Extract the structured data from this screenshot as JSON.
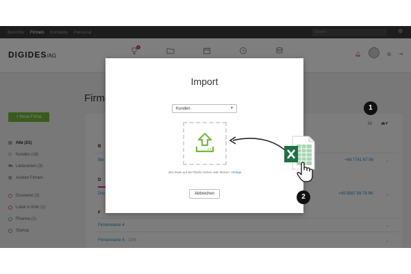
{
  "topnav": {
    "items": [
      {
        "label": "Berichte",
        "active": false
      },
      {
        "label": "Firmen",
        "active": true
      },
      {
        "label": "Kontakte",
        "active": false
      },
      {
        "label": "Personal",
        "active": false
      }
    ],
    "search_placeholder": "Suchen",
    "settings_icon": "gear-icon"
  },
  "header": {
    "logo": "DIGIDES",
    "logo_sub": "/AG",
    "icons": [
      "trophy-icon",
      "folder-icon",
      "calendar-icon",
      "clock-icon",
      "database-icon"
    ],
    "badge_count": "1",
    "right_icons": [
      "bell-icon",
      "avatar",
      "globe-icon",
      "logout-icon"
    ]
  },
  "page": {
    "title": "Firmen",
    "new_button": "+ Neue Firma"
  },
  "sidebar": {
    "groups": [
      {
        "label": "Alle (21)",
        "icon": "building-icon"
      },
      {
        "label": "Kunden (18)",
        "icon": "cart-icon"
      },
      {
        "label": "Lieferanten (3)",
        "icon": "truck-icon"
      },
      {
        "label": "Andere Firmen",
        "icon": "buildings-icon"
      }
    ],
    "tags": [
      {
        "label": "Druckerei (2)",
        "color": "#e07a4a"
      },
      {
        "label": "Lokal in Köln (1)",
        "color": "#e05a5a"
      },
      {
        "label": "Pharma (1)",
        "color": "#3fb8c6"
      },
      {
        "label": "Startup",
        "color": "#888888"
      }
    ]
  },
  "list": {
    "sections": [
      {
        "letter": "B",
        "name": "Bei",
        "phone": "+49 7741 67 56"
      },
      {
        "letter": "D",
        "name": "Dru",
        "phone": "+49 5567 56 78 99"
      },
      {
        "letter": "F",
        "name": "Firmenname 4",
        "phone": ""
      }
    ],
    "extra_row": {
      "name": "Firmenname 5",
      "suffix": " - 10%"
    }
  },
  "modal": {
    "title": "Import",
    "select_value": "Kunden",
    "hint_text": ".xlsx Datei auf die Fläche ziehen oder klicken.",
    "hint_link": "Vorlage",
    "cancel_button": "Abbrechen"
  },
  "annotations": {
    "step1": "1",
    "step2": "2"
  },
  "colors": {
    "accent_green": "#74b73d",
    "link_blue": "#1e89c8",
    "excel_green": "#1e7145"
  }
}
